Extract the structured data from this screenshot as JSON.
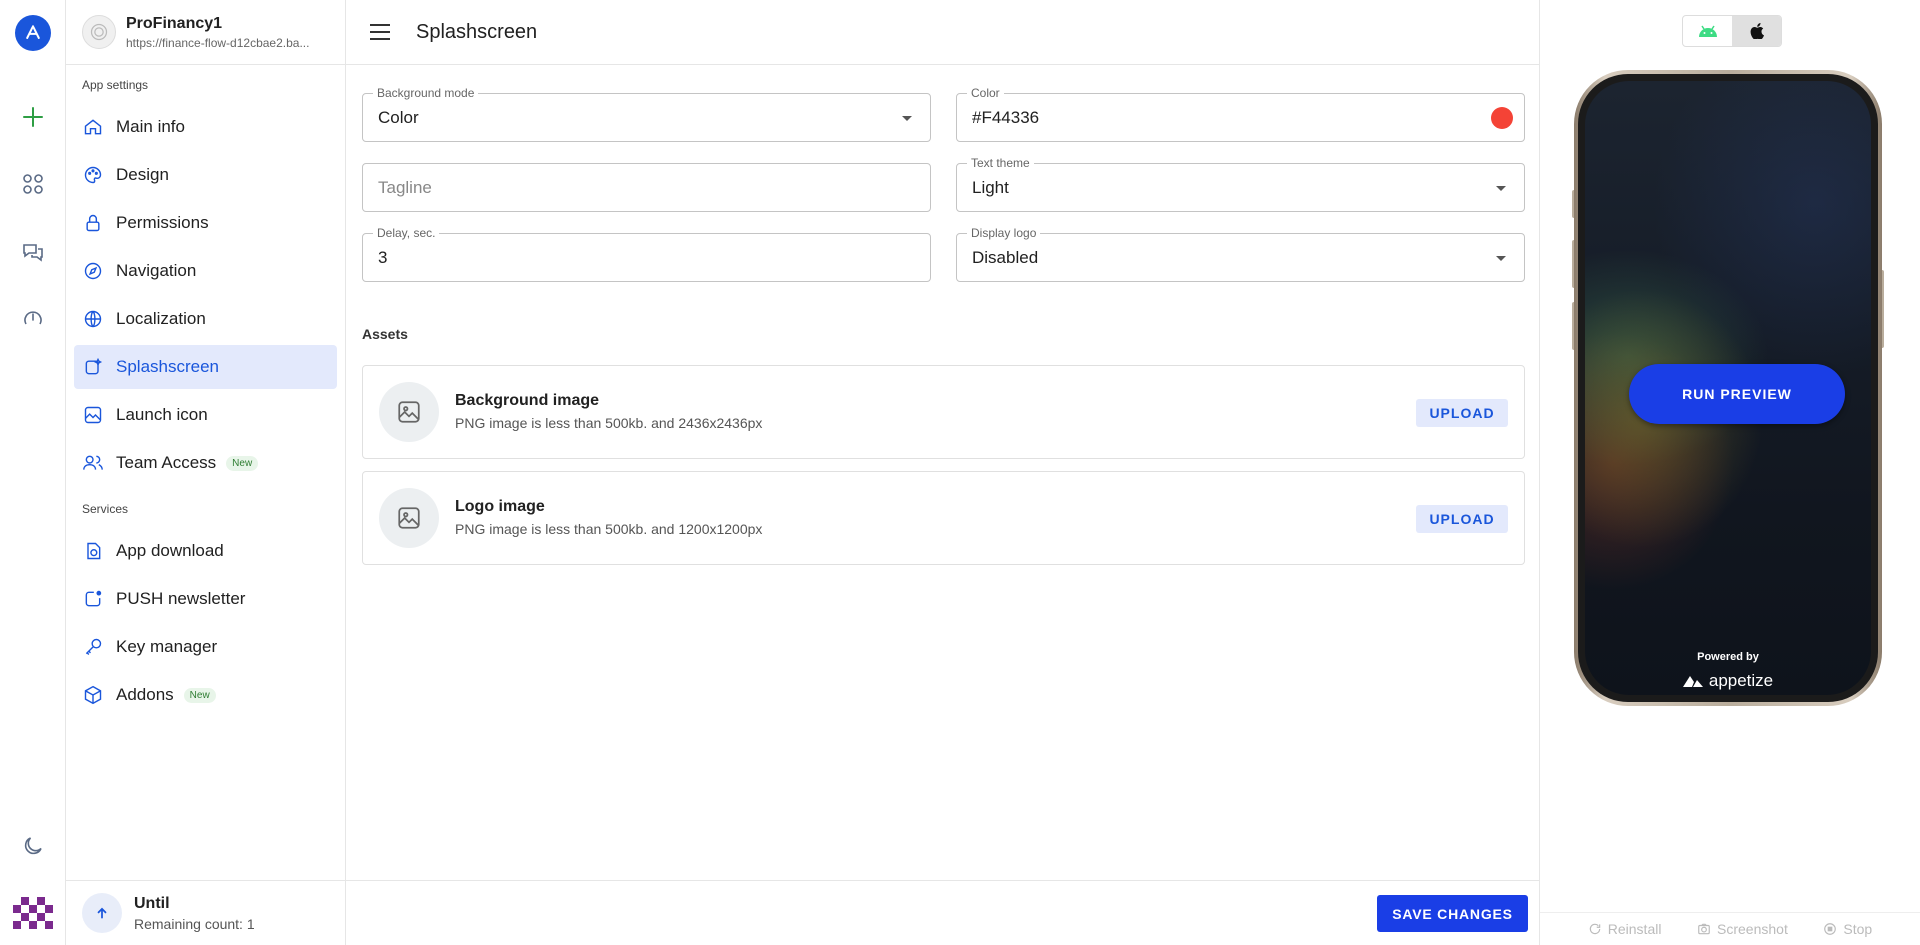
{
  "app": {
    "name": "ProFinancy1",
    "url": "https://finance-flow-d12cbae2.ba..."
  },
  "sidebar": {
    "section_app_settings": "App settings",
    "items": [
      {
        "label": "Main info",
        "icon": "home-icon"
      },
      {
        "label": "Design",
        "icon": "palette-icon"
      },
      {
        "label": "Permissions",
        "icon": "lock-icon"
      },
      {
        "label": "Navigation",
        "icon": "compass-icon"
      },
      {
        "label": "Localization",
        "icon": "globe-icon"
      },
      {
        "label": "Splashscreen",
        "icon": "splash-icon",
        "active": true
      },
      {
        "label": "Launch icon",
        "icon": "image-icon"
      },
      {
        "label": "Team Access",
        "icon": "team-icon",
        "badge": "New"
      }
    ],
    "section_services": "Services",
    "services": [
      {
        "label": "App download",
        "icon": "download-icon"
      },
      {
        "label": "PUSH newsletter",
        "icon": "push-icon"
      },
      {
        "label": "Key manager",
        "icon": "key-icon"
      },
      {
        "label": "Addons",
        "icon": "cube-icon",
        "badge": "New"
      }
    ],
    "footer": {
      "title": "Until",
      "subtitle": "Remaining count: 1"
    }
  },
  "header": {
    "title": "Splashscreen"
  },
  "form": {
    "background_mode": {
      "label": "Background mode",
      "value": "Color"
    },
    "color": {
      "label": "Color",
      "value": "#F44336",
      "swatch": "#F44336"
    },
    "tagline": {
      "placeholder": "Tagline",
      "value": ""
    },
    "text_theme": {
      "label": "Text theme",
      "value": "Light"
    },
    "delay": {
      "label": "Delay, sec.",
      "value": "3"
    },
    "display_logo": {
      "label": "Display logo",
      "value": "Disabled"
    }
  },
  "assets": {
    "label": "Assets",
    "items": [
      {
        "title": "Background image",
        "description": "PNG image is less than 500kb. and 2436x2436px",
        "button": "UPLOAD"
      },
      {
        "title": "Logo image",
        "description": "PNG image is less than 500kb. and 1200x1200px",
        "button": "UPLOAD"
      }
    ]
  },
  "actions": {
    "save": "SAVE CHANGES"
  },
  "preview": {
    "os_selected": "ios",
    "run_button": "RUN PREVIEW",
    "powered_by": "Powered by",
    "brand": "appetize",
    "footer": {
      "reinstall": "Reinstall",
      "screenshot": "Screenshot",
      "stop": "Stop"
    }
  },
  "colors": {
    "accent": "#1A56DB",
    "primary_button": "#1A3EE6",
    "active_bg": "#E3E9FC",
    "android_green": "#3DDC84"
  }
}
